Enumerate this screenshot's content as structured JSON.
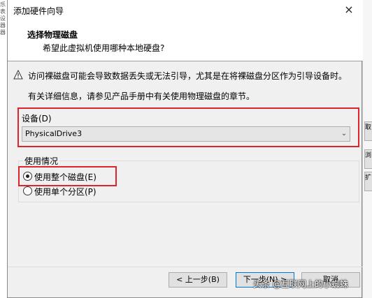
{
  "window": {
    "title": "添加硬件向导",
    "close_glyph": "×"
  },
  "header": {
    "title": "选择物理磁盘",
    "subtitle": "希望此虚拟机使用哪种本地硬盘?"
  },
  "warning": {
    "text": "访问裸磁盘可能会导致数据丢失或无法引导，尤其是在将裸磁盘分区作为引导设备时。",
    "info": "有关详细信息，请参见产品手册中有关使用物理磁盘的章节。"
  },
  "device": {
    "label": "设备(D)",
    "selected": "PhysicalDrive3",
    "arrow_glyph": "⌄"
  },
  "usage": {
    "label": "使用情况",
    "options": [
      {
        "label": "使用整个磁盘(E)",
        "checked": true
      },
      {
        "label": "使用单个分区(P)",
        "checked": false
      }
    ]
  },
  "buttons": {
    "back": "< 上一步(B)",
    "next": "下一步(N) >",
    "cancel": "取消"
  },
  "background": {
    "left_chars": [
      "乐",
      "表",
      "设",
      "器",
      "器"
    ],
    "right_buttons": [
      "取",
      "浏",
      "扩"
    ]
  },
  "watermark": "头条 @互联网上的小蜘蛛",
  "colors": {
    "highlight_red": "#e0242b",
    "focus_blue": "#0078d7"
  }
}
